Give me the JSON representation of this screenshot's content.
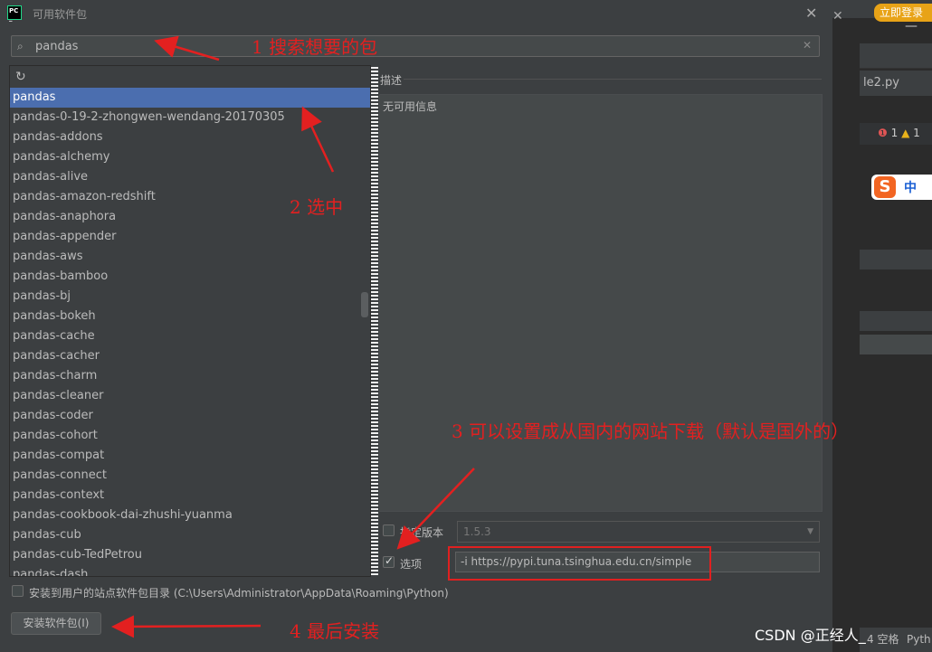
{
  "dialog": {
    "title": "可用软件包",
    "search_value": "pandas",
    "packages": [
      "pandas",
      "pandas-0-19-2-zhongwen-wendang-20170305",
      "pandas-addons",
      "pandas-alchemy",
      "pandas-alive",
      "pandas-amazon-redshift",
      "pandas-anaphora",
      "pandas-appender",
      "pandas-aws",
      "pandas-bamboo",
      "pandas-bj",
      "pandas-bokeh",
      "pandas-cache",
      "pandas-cacher",
      "pandas-charm",
      "pandas-cleaner",
      "pandas-coder",
      "pandas-cohort",
      "pandas-compat",
      "pandas-connect",
      "pandas-context",
      "pandas-cookbook-dai-zhushi-yuanma",
      "pandas-cub",
      "pandas-cub-TedPetrou",
      "pandas-dash"
    ],
    "selected_package": "pandas",
    "description_label": "描述",
    "description_text": "无可用信息",
    "specify_version_label": "指定版本",
    "specify_version_checked": false,
    "version_value": "1.5.3",
    "options_label": "选项",
    "options_checked": true,
    "options_value": "-i https://pypi.tuna.tsinghua.edu.cn/simple",
    "user_site_label": "安装到用户的站点软件包目录 (C:\\Users\\Administrator\\AppData\\Roaming\\Python)",
    "install_button": "安装软件包(I)"
  },
  "annotations": {
    "a1": "1  搜索想要的包",
    "a2": "2  选中",
    "a3": "3  可以设置成从国内的网站下载（默认是国外的）",
    "a4": "4  最后安装",
    "color": "#e32020"
  },
  "background_ide": {
    "login_button": "立即登录",
    "file_tab": "le2.py",
    "errors": "1",
    "warnings": "1",
    "ime": "中",
    "status_text": "4 空格",
    "status_text2": "Pyth"
  },
  "watermark": "CSDN @正经人_"
}
